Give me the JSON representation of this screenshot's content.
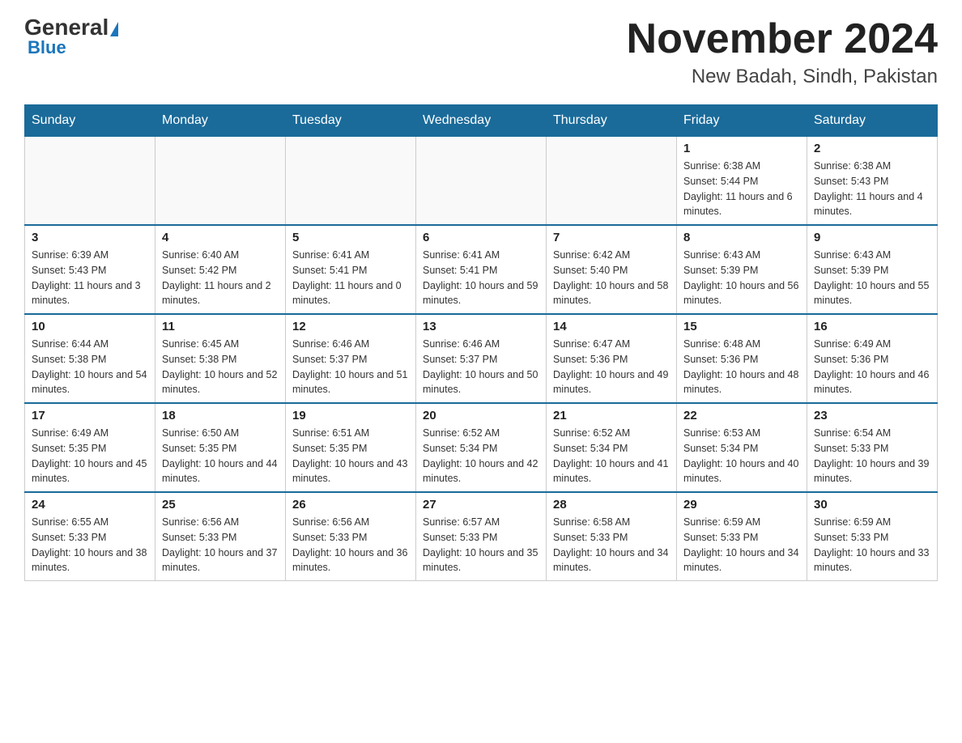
{
  "logo": {
    "general": "General",
    "blue": "Blue"
  },
  "title": "November 2024",
  "subtitle": "New Badah, Sindh, Pakistan",
  "headers": [
    "Sunday",
    "Monday",
    "Tuesday",
    "Wednesday",
    "Thursday",
    "Friday",
    "Saturday"
  ],
  "weeks": [
    [
      {
        "day": "",
        "info": ""
      },
      {
        "day": "",
        "info": ""
      },
      {
        "day": "",
        "info": ""
      },
      {
        "day": "",
        "info": ""
      },
      {
        "day": "",
        "info": ""
      },
      {
        "day": "1",
        "info": "Sunrise: 6:38 AM\nSunset: 5:44 PM\nDaylight: 11 hours and 6 minutes."
      },
      {
        "day": "2",
        "info": "Sunrise: 6:38 AM\nSunset: 5:43 PM\nDaylight: 11 hours and 4 minutes."
      }
    ],
    [
      {
        "day": "3",
        "info": "Sunrise: 6:39 AM\nSunset: 5:43 PM\nDaylight: 11 hours and 3 minutes."
      },
      {
        "day": "4",
        "info": "Sunrise: 6:40 AM\nSunset: 5:42 PM\nDaylight: 11 hours and 2 minutes."
      },
      {
        "day": "5",
        "info": "Sunrise: 6:41 AM\nSunset: 5:41 PM\nDaylight: 11 hours and 0 minutes."
      },
      {
        "day": "6",
        "info": "Sunrise: 6:41 AM\nSunset: 5:41 PM\nDaylight: 10 hours and 59 minutes."
      },
      {
        "day": "7",
        "info": "Sunrise: 6:42 AM\nSunset: 5:40 PM\nDaylight: 10 hours and 58 minutes."
      },
      {
        "day": "8",
        "info": "Sunrise: 6:43 AM\nSunset: 5:39 PM\nDaylight: 10 hours and 56 minutes."
      },
      {
        "day": "9",
        "info": "Sunrise: 6:43 AM\nSunset: 5:39 PM\nDaylight: 10 hours and 55 minutes."
      }
    ],
    [
      {
        "day": "10",
        "info": "Sunrise: 6:44 AM\nSunset: 5:38 PM\nDaylight: 10 hours and 54 minutes."
      },
      {
        "day": "11",
        "info": "Sunrise: 6:45 AM\nSunset: 5:38 PM\nDaylight: 10 hours and 52 minutes."
      },
      {
        "day": "12",
        "info": "Sunrise: 6:46 AM\nSunset: 5:37 PM\nDaylight: 10 hours and 51 minutes."
      },
      {
        "day": "13",
        "info": "Sunrise: 6:46 AM\nSunset: 5:37 PM\nDaylight: 10 hours and 50 minutes."
      },
      {
        "day": "14",
        "info": "Sunrise: 6:47 AM\nSunset: 5:36 PM\nDaylight: 10 hours and 49 minutes."
      },
      {
        "day": "15",
        "info": "Sunrise: 6:48 AM\nSunset: 5:36 PM\nDaylight: 10 hours and 48 minutes."
      },
      {
        "day": "16",
        "info": "Sunrise: 6:49 AM\nSunset: 5:36 PM\nDaylight: 10 hours and 46 minutes."
      }
    ],
    [
      {
        "day": "17",
        "info": "Sunrise: 6:49 AM\nSunset: 5:35 PM\nDaylight: 10 hours and 45 minutes."
      },
      {
        "day": "18",
        "info": "Sunrise: 6:50 AM\nSunset: 5:35 PM\nDaylight: 10 hours and 44 minutes."
      },
      {
        "day": "19",
        "info": "Sunrise: 6:51 AM\nSunset: 5:35 PM\nDaylight: 10 hours and 43 minutes."
      },
      {
        "day": "20",
        "info": "Sunrise: 6:52 AM\nSunset: 5:34 PM\nDaylight: 10 hours and 42 minutes."
      },
      {
        "day": "21",
        "info": "Sunrise: 6:52 AM\nSunset: 5:34 PM\nDaylight: 10 hours and 41 minutes."
      },
      {
        "day": "22",
        "info": "Sunrise: 6:53 AM\nSunset: 5:34 PM\nDaylight: 10 hours and 40 minutes."
      },
      {
        "day": "23",
        "info": "Sunrise: 6:54 AM\nSunset: 5:33 PM\nDaylight: 10 hours and 39 minutes."
      }
    ],
    [
      {
        "day": "24",
        "info": "Sunrise: 6:55 AM\nSunset: 5:33 PM\nDaylight: 10 hours and 38 minutes."
      },
      {
        "day": "25",
        "info": "Sunrise: 6:56 AM\nSunset: 5:33 PM\nDaylight: 10 hours and 37 minutes."
      },
      {
        "day": "26",
        "info": "Sunrise: 6:56 AM\nSunset: 5:33 PM\nDaylight: 10 hours and 36 minutes."
      },
      {
        "day": "27",
        "info": "Sunrise: 6:57 AM\nSunset: 5:33 PM\nDaylight: 10 hours and 35 minutes."
      },
      {
        "day": "28",
        "info": "Sunrise: 6:58 AM\nSunset: 5:33 PM\nDaylight: 10 hours and 34 minutes."
      },
      {
        "day": "29",
        "info": "Sunrise: 6:59 AM\nSunset: 5:33 PM\nDaylight: 10 hours and 34 minutes."
      },
      {
        "day": "30",
        "info": "Sunrise: 6:59 AM\nSunset: 5:33 PM\nDaylight: 10 hours and 33 minutes."
      }
    ]
  ]
}
